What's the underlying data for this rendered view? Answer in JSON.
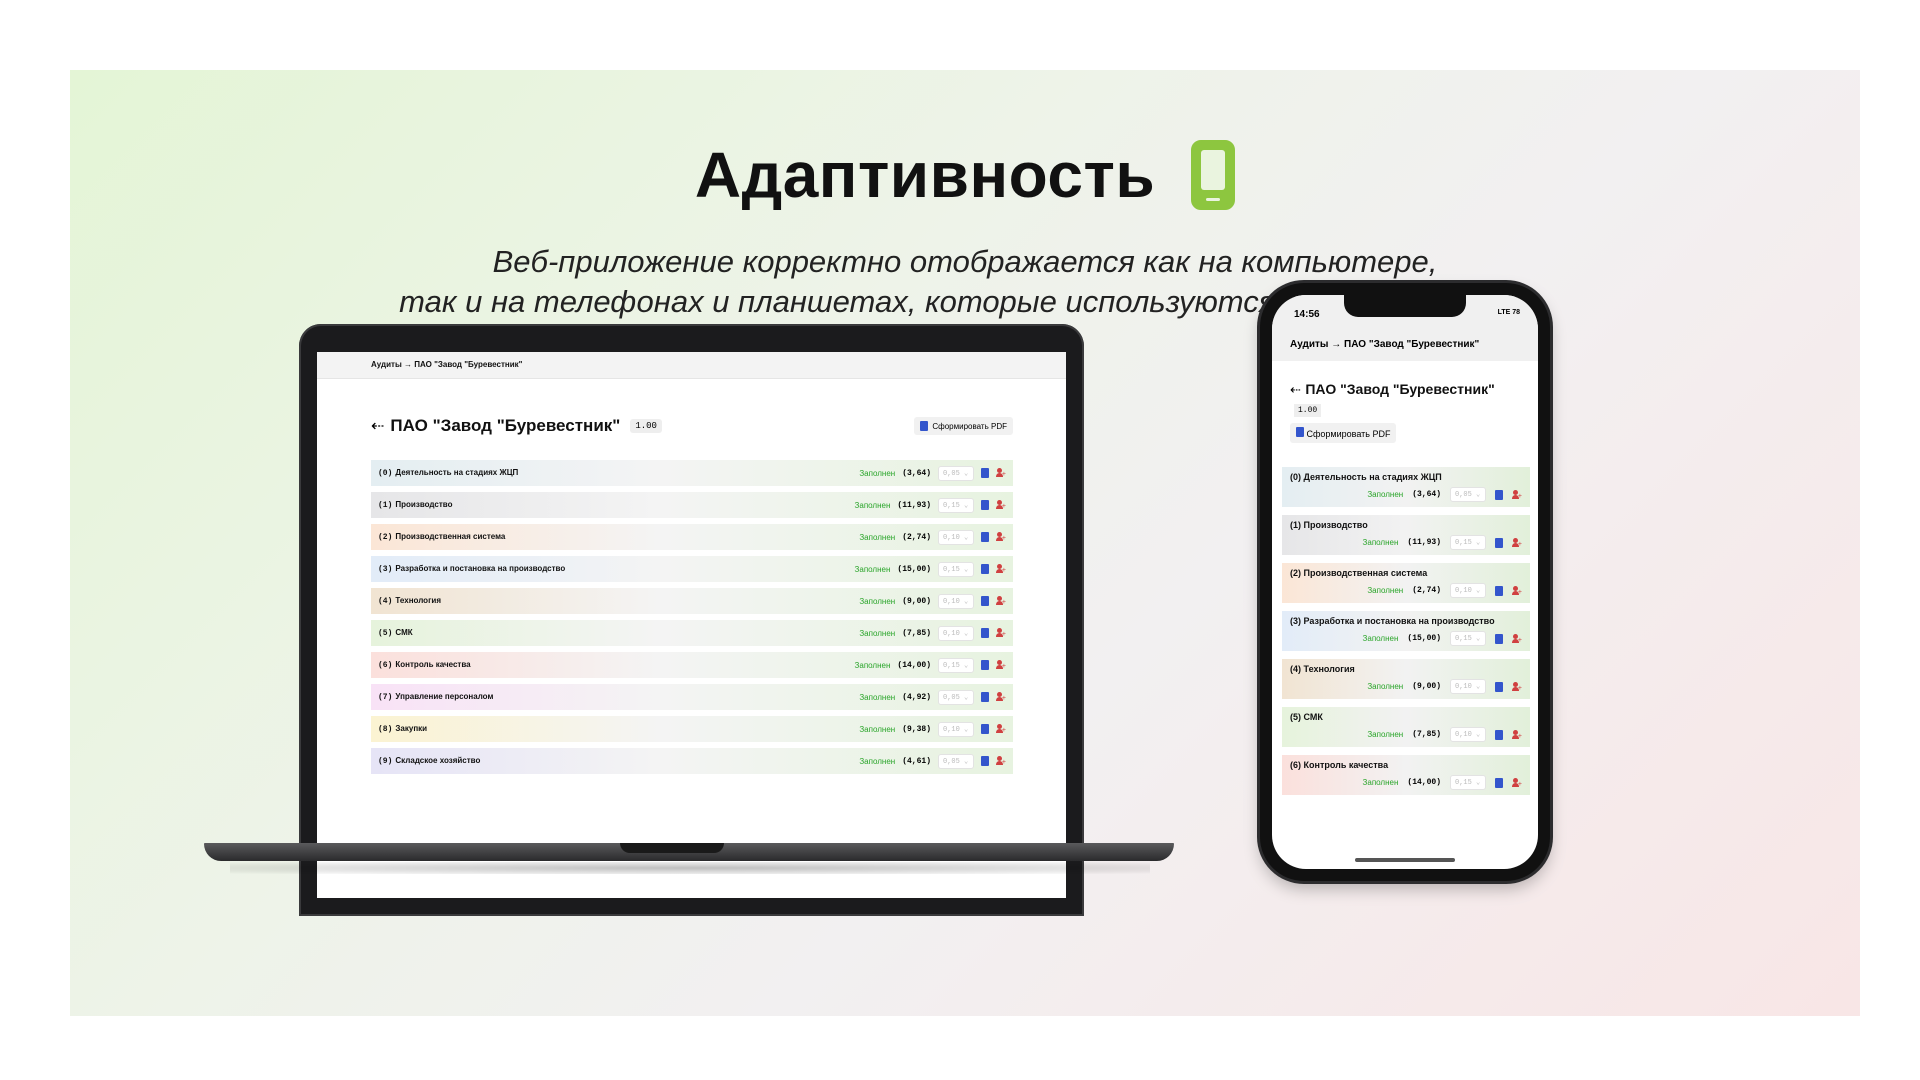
{
  "page": {
    "title": "Адаптивность",
    "subtitle_line1": "Веб-приложение корректно отображается как на компьютере,",
    "subtitle_line2": "так и на телефонах и планшетах, которые используются во время аудита"
  },
  "app": {
    "breadcrumb": "Аудиты → ПАО \"Завод \"Буревестник\"",
    "back_arrow": "⇠",
    "org_name": "ПАО \"Завод \"Буревестник\"",
    "version": "1.00",
    "pdf_button": "Сформировать PDF",
    "status_label": "Заполнен",
    "sections": [
      {
        "num": "(0)",
        "name": "Деятельность на стадиях ЖЦП",
        "score": "(3,64)",
        "weight": "0,05 ⌄",
        "color": "#e4eef2"
      },
      {
        "num": "(1)",
        "name": "Производство",
        "score": "(11,93)",
        "weight": "0,15 ⌄",
        "color": "#e6e6e8"
      },
      {
        "num": "(2)",
        "name": "Производственная система",
        "score": "(2,74)",
        "weight": "0,10 ⌄",
        "color": "#fbe6d6"
      },
      {
        "num": "(3)",
        "name": "Разработка и постановка на производство",
        "score": "(15,00)",
        "weight": "0,15 ⌄",
        "color": "#e2ecf8"
      },
      {
        "num": "(4)",
        "name": "Технология",
        "score": "(9,00)",
        "weight": "0,10 ⌄",
        "color": "#f1e4d2"
      },
      {
        "num": "(5)",
        "name": "СМК",
        "score": "(7,85)",
        "weight": "0,10 ⌄",
        "color": "#e6f3dc"
      },
      {
        "num": "(6)",
        "name": "Контроль качества",
        "score": "(14,00)",
        "weight": "0,15 ⌄",
        "color": "#fbe0dc"
      },
      {
        "num": "(7)",
        "name": "Управление персоналом",
        "score": "(4,92)",
        "weight": "0,05 ⌄",
        "color": "#f8e2f6"
      },
      {
        "num": "(8)",
        "name": "Закупки",
        "score": "(9,38)",
        "weight": "0,10 ⌄",
        "color": "#fbf3d2"
      },
      {
        "num": "(9)",
        "name": "Складское хозяйство",
        "score": "(4,61)",
        "weight": "0,05 ⌄",
        "color": "#e6e4f6"
      }
    ]
  },
  "phone": {
    "time": "14:56",
    "signal": "LTE 78"
  },
  "colors": {
    "accent_green": "#8dc63f",
    "status_green": "#2aa52a",
    "pdf_icon": "#3355cc",
    "user_icon": "#d04040"
  }
}
